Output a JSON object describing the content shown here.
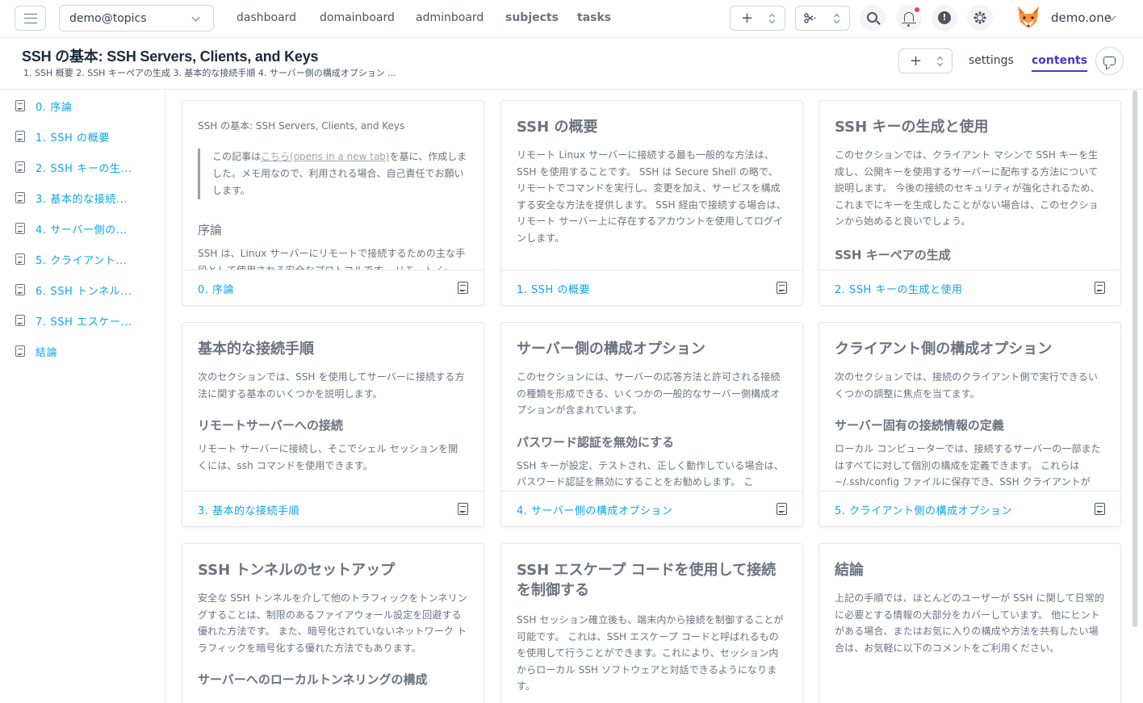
{
  "topbar": {
    "workspace": "demo@topics",
    "nav": [
      "dashboard",
      "domainboard",
      "adminboard",
      "subjects",
      "tasks"
    ],
    "user": "demo.one"
  },
  "header": {
    "title": "SSH の基本: SSH Servers, Clients, and Keys",
    "breadcrumb": "1. SSH 概要 2. SSH キーペアの生成 3. 基本的な接続手順 4. サーバー側の構成オプション ...",
    "settings": "settings",
    "contents": "contents"
  },
  "sidebar": {
    "items": [
      "0. 序論",
      "1. SSH の概要",
      "2. SSH キーの生...",
      "3. 基本的な接続...",
      "4. サーバー側の...",
      "5. クライアント...",
      "6. SSH トンネル...",
      "7. SSH エスケー...",
      "結論"
    ]
  },
  "cards": [
    {
      "small_title": "SSH の基本: SSH Servers, Clients, and Keys",
      "quote_pre": "この記事は",
      "quote_link": "こちら(opens in a new tab)",
      "quote_post": "を基に、作成しました。メモ用なので、利用される場合、自己責任でお願いします。",
      "heading": "序論",
      "text": "SSH は、Linux サーバーにリモートで接続するための主な手段として使用される安全なプロトコルです。 リモート シ",
      "footer": "0. 序論"
    },
    {
      "title": "SSH の概要",
      "text": "リモート Linux サーバーに接続する最も一般的な方法は、SSH を使用することです。 SSH は Secure Shell の略で、リモートでコマンドを実行し、変更を加え、サービスを構成する安全な方法を提供します。 SSH 経由で接続する場合は、リモート サーバー上に存在するアカウントを使用してログインします。",
      "footer": "1. SSH の概要"
    },
    {
      "title": "SSH キーの生成と使用",
      "text": "このセクションでは、クライアント マシンで SSH キーを生成し、公開キーを使用するサーバーに配布する方法について説明します。 今後の接続のセキュリティが強化されるため、これまでにキーを生成したことがない場合は、このセクションから始めると良いでしょう。",
      "heading": "SSH キーペアの生成",
      "footer": "2. SSH キーの生成と使用"
    },
    {
      "title": "基本的な接続手順",
      "text": "次のセクションでは、SSH を使用してサーバーに接続する方法に関する基本のいくつかを説明します。",
      "heading": "リモートサーバーへの接続",
      "text2": "リモート サーバーに接続し、そこでシェル セッションを開くには、ssh コマンドを使用できます。",
      "footer": "3. 基本的な接続手順"
    },
    {
      "title": "サーバー側の構成オプション",
      "text": "このセクションには、サーバーの応答方法と許可される接続の種類を形成できる、いくつかの一般的なサーバー側構成オプションが含まれています。",
      "heading": "パスワード認証を無効にする",
      "text2": "SSH キーが設定、テストされ、正しく動作している場合は、パスワード認証を無効にすることをお勧めします。 こ",
      "footer": "4. サーバー側の構成オプション"
    },
    {
      "title": "クライアント側の構成オプション",
      "text": "次のセクションでは、接続のクライアント側で実行できるいくつかの調整に焦点を当てます。",
      "heading": "サーバー固有の接続情報の定義",
      "text2": "ローカル コンピューターでは、接続するサーバーの一部またはすべてに対して個別の構成を定義できます。 これらは ~/.ssh/config ファイルに保存でき、SSH クライアントが",
      "footer": "5. クライアント側の構成オプション"
    },
    {
      "title": "SSH トンネルのセットアップ",
      "text": "安全な SSH トンネルを介して他のトラフィックをトンネリングすることは、制限のあるファイアウォール設定を回避する優れた方法です。 また、暗号化されていないネットワーク トラフィックを暗号化する優れた方法でもあります。",
      "heading": "サーバーへのローカルトンネリングの構成"
    },
    {
      "title": "SSH エスケープ コードを使用して接続を制御する",
      "text": "SSH セッション確立後も、端末内から接続を制御することが可能です。 これは、SSH エスケープ コードと呼ばれるものを使用して行うことができます。これにより、セッション内からローカル SSH ソフトウェアと対話できるようになります。"
    },
    {
      "title": "結論",
      "text": "上記の手順では、ほとんどのユーザーが SSH に関して日常的に必要とする情報の大部分をカバーしています。 他にヒントがある場合、またはお気に入りの構成や方法を共有したい場合は、お気軽に以下のコメントをご利用ください。"
    }
  ]
}
